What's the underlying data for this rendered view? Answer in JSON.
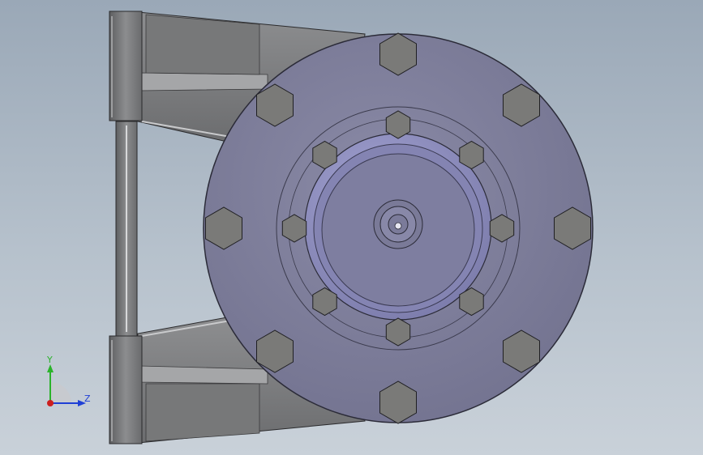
{
  "triad": {
    "y_label": "Y",
    "z_label": "Z",
    "colors": {
      "y": "#2bb32b",
      "z": "#1f3fd6",
      "x": "#cc1f1f"
    }
  },
  "model": {
    "colors": {
      "bracket": "#6f7072",
      "bracket_light": "#9a9b9d",
      "bracket_dark": "#4c4d4f",
      "flange": "#7c7c97",
      "flange_edge": "#2b2b38",
      "hub": "#8a8ab0",
      "hub_inner": "#9898c4",
      "bolt": "#7a7a78"
    },
    "large_bolts": 8,
    "small_bolts": 8
  }
}
